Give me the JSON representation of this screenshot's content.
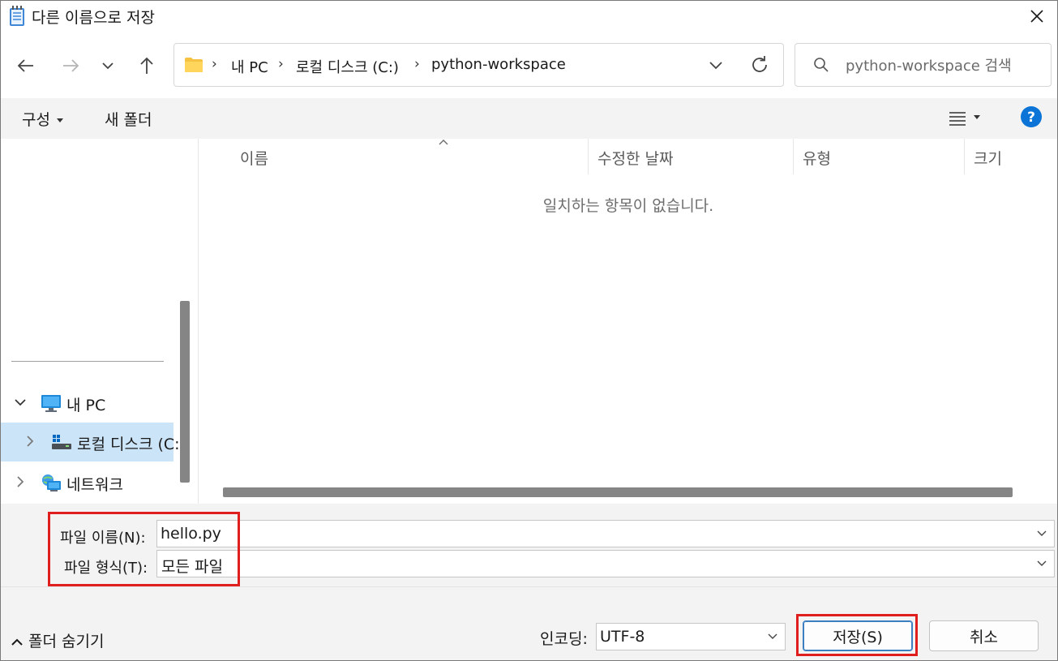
{
  "window": {
    "title": "다른 이름으로 저장",
    "icons": {
      "app": "notepad-icon",
      "close": "close-icon"
    }
  },
  "nav": {
    "icons": {
      "back": "back-arrow-icon",
      "forward": "forward-arrow-icon",
      "recent": "chevron-down-icon",
      "up": "up-arrow-icon"
    },
    "breadcrumb": [
      "내 PC",
      "로컬 디스크 (C:)",
      "python-workspace"
    ],
    "search_placeholder": "python-workspace 검색"
  },
  "commandbar": {
    "organize": "구성",
    "new_folder": "새 폴더"
  },
  "tree": {
    "items": [
      {
        "label": "내 PC",
        "icon": "computer-icon",
        "expanded": true
      },
      {
        "label": "로컬 디스크 (C:)",
        "icon": "drive-icon",
        "selected": true
      },
      {
        "label": "네트워크",
        "icon": "network-icon",
        "expanded": false
      }
    ]
  },
  "filelist": {
    "columns": [
      "이름",
      "수정한 날짜",
      "유형",
      "크기"
    ],
    "empty_message": "일치하는 항목이 없습니다."
  },
  "form": {
    "filename_label": "파일 이름(N):",
    "filename_value": "hello.py",
    "filetype_label": "파일 형식(T):",
    "filetype_value": "모든 파일",
    "hide_folders": "폴더 숨기기",
    "encoding_label": "인코딩:",
    "encoding_value": "UTF-8",
    "save": "저장(S)",
    "cancel": "취소"
  },
  "colors": {
    "accent": "#0078d4",
    "selection": "#cce4f7",
    "highlight": "#e01e1e",
    "folder": "#f5c242"
  }
}
